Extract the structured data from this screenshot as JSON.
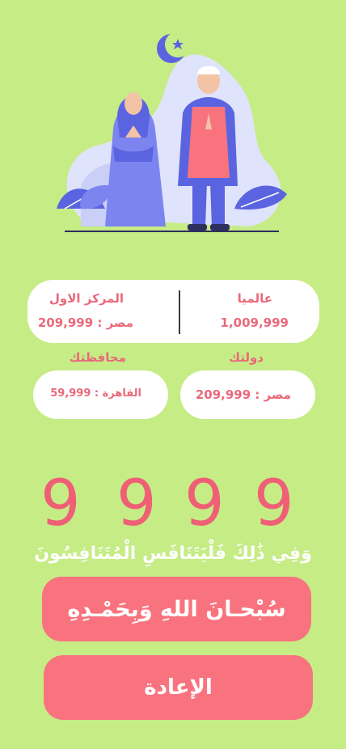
{
  "stats": {
    "global_label": "عالميا",
    "global_value": "1,009,999",
    "first_place_label": "المركز الاول",
    "first_place_value": "مصر : 209,999",
    "country_label": "دولتك",
    "country_value": "مصر : 209,999",
    "governorate_label": "محافظتك",
    "governorate_value": "القاهرة : 59,999"
  },
  "counter": {
    "digits": [
      "9",
      "9",
      "9",
      "9"
    ]
  },
  "verse": "وَفِي ذَٰلِكَ فَلْيَتَنَافَسِ الْمُتَنَافِسُونَ",
  "buttons": {
    "tasbih_label": "سُبْحـانَ اللهِ وَبِحَمْـدِهِ",
    "reset_label": "الإعادة"
  },
  "colors": {
    "background": "#c6ec86",
    "accent": "#f9737f",
    "text_accent": "#e9697a",
    "digits": "#ef5f75"
  }
}
